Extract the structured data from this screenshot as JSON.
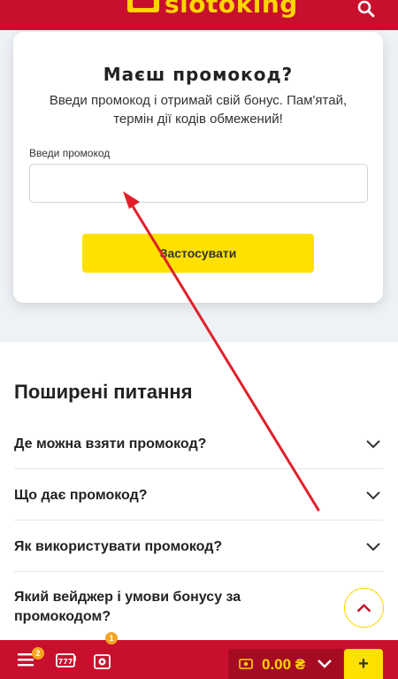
{
  "header": {
    "logo_text": "slotoking",
    "search_icon": "search-icon",
    "bg_color": "#c8102e",
    "logo_color": "#ffd400"
  },
  "promo": {
    "title": "Маєш промокод?",
    "description": "Введи промокод і отримай свій бонус. Пам'ятай, термін дії кодів обмежений!",
    "input_label": "Введи промокод",
    "input_value": "",
    "apply_label": "Застосувати",
    "apply_color": "#ffe100"
  },
  "faq": {
    "title": "Поширені питання",
    "items": [
      {
        "question": "Де можна взяти промокод?"
      },
      {
        "question": "Що дає промокод?"
      },
      {
        "question": "Як використувати промокод?"
      },
      {
        "question": "Який вейджер і умови бонусу за промокодом?"
      }
    ]
  },
  "bottom_bar": {
    "menu_badge": "2",
    "slots_icon": "slot-777-icon",
    "gift_badge": "1",
    "balance": "0.00 ₴",
    "plus_label": "+"
  },
  "annotation_color": "#e0202a"
}
